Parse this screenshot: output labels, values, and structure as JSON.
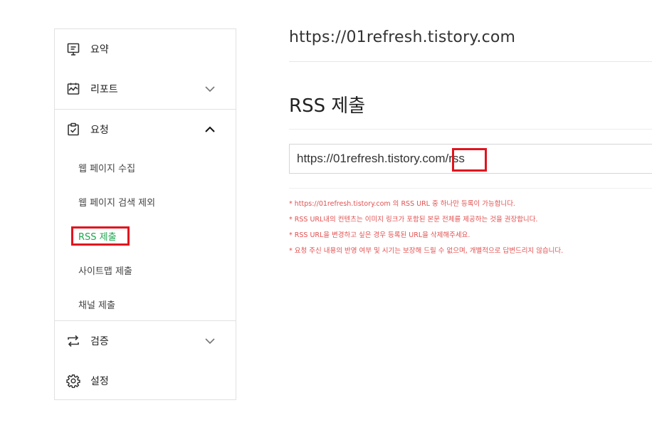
{
  "sidebar": {
    "items": [
      {
        "label": "요약",
        "icon": "summary-icon"
      },
      {
        "label": "리포트",
        "icon": "report-icon",
        "expanded": false
      },
      {
        "label": "요청",
        "icon": "request-icon",
        "expanded": true
      },
      {
        "label": "검증",
        "icon": "verify-icon",
        "expanded": false
      },
      {
        "label": "설정",
        "icon": "settings-icon"
      }
    ],
    "sub_items": [
      {
        "label": "웹 페이지 수집"
      },
      {
        "label": "웹 페이지 검색 제외"
      },
      {
        "label": "RSS 제출",
        "active": true
      },
      {
        "label": "사이트맵 제출"
      },
      {
        "label": "채널 제출"
      }
    ]
  },
  "main": {
    "site_url": "https://01refresh.tistory.com",
    "section_title": "RSS 제출",
    "rss_input_value": "https://01refresh.tistory.com/rss",
    "notices": [
      "* https://01refresh.tistory.com 의 RSS URL 중 하나만 등록이 가능합니다.",
      "* RSS URL내의 컨텐츠는 이미지 링크가 포함된 본문 전체를 제공하는 것을 권장합니다.",
      "* RSS URL을 변경하고 싶은 경우 등록된 URL을 삭제해주세요.",
      "* 요청 주신 내용의 반영 여부 및 시기는 보장해 드릴 수 없으며, 개별적으로 답변드리지 않습니다."
    ]
  },
  "colors": {
    "active_green": "#1fa64f",
    "highlight_red": "#e0141e",
    "notice_red": "#e25050",
    "border": "#e1e1e1"
  }
}
